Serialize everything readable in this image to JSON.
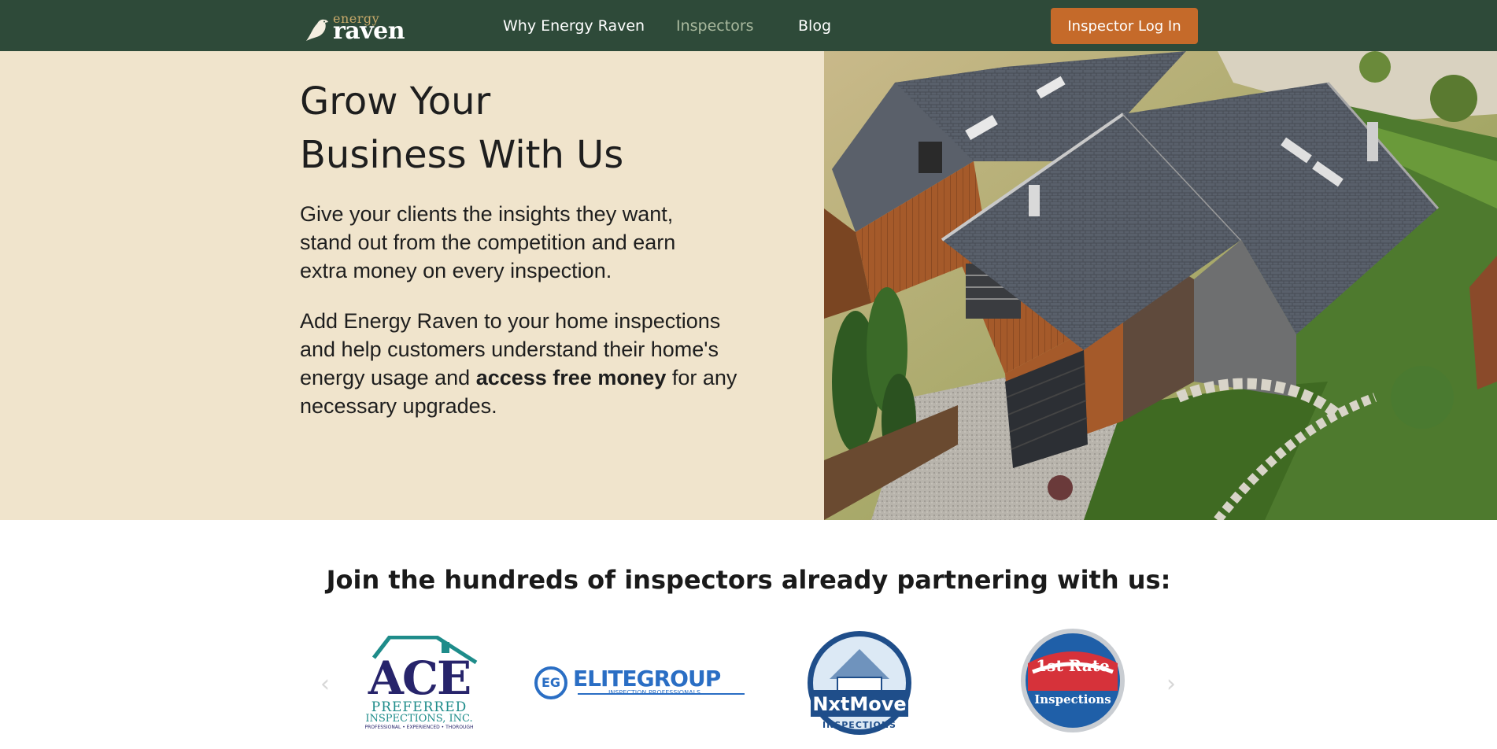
{
  "nav": {
    "logo_small": "energy",
    "logo_big": "raven",
    "links": [
      {
        "label": "Why Energy Raven",
        "active": false
      },
      {
        "label": "Inspectors",
        "active": true
      },
      {
        "label": "Blog",
        "active": false
      }
    ],
    "login_label": "Inspector Log In"
  },
  "hero": {
    "title_line1": "Grow Your",
    "title_line2": "Business With Us",
    "paragraph1": "Give your clients the insights they want, stand out from the competition and earn extra money on every inspection.",
    "paragraph2_start": "Add Energy Raven to your home inspections and help customers understand their home's energy usage and ",
    "paragraph2_bold": "access free money",
    "paragraph2_end": " for any necessary upgrades.",
    "image_alt": "aerial view of house with dark shingle roof"
  },
  "partners": {
    "heading": "Join the hundreds of inspectors already partnering with us:",
    "prev_arrow": "‹",
    "next_arrow": "›",
    "logos": [
      {
        "name": "ACE",
        "line2": "PREFERRED",
        "line3": "INSPECTIONS, INC.",
        "tagline": "PROFESSIONAL • EXPERIENCED • THOROUGH"
      },
      {
        "name": "ELITEGROUP",
        "tagline": "INSPECTION PROFESSIONALS",
        "badge": "EG"
      },
      {
        "name": "NxtMove",
        "tagline": "INSPECTIONS"
      },
      {
        "name": "1st Rate",
        "tagline": "Inspections"
      }
    ]
  },
  "colors": {
    "nav_bg": "#2e4a39",
    "accent": "#c56a2a",
    "hero_bg": "#f0e4cc"
  }
}
